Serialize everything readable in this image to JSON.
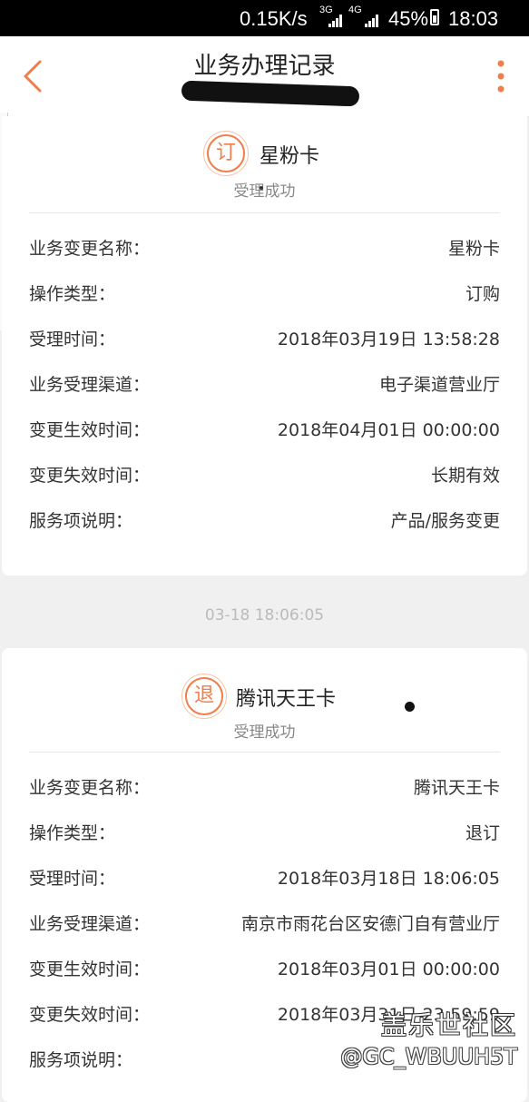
{
  "status_bar": {
    "speed": "0.15K/s",
    "net_a": "3G",
    "net_b": "4G",
    "battery": "45%",
    "time": "18:03"
  },
  "header": {
    "title": "业务办理记录",
    "back_icon": "chevron-left-icon",
    "more_icon": "more-vertical-icon",
    "accent": "#ef7e4a"
  },
  "labels": {
    "name": "业务变更名称：",
    "op_type": "操作类型：",
    "accept_time": "受理时间：",
    "channel": "业务受理渠道：",
    "effective": "变更生效时间：",
    "expire": "变更失效时间：",
    "desc": "服务项说明："
  },
  "records": [
    {
      "badge": "订",
      "name": "星粉卡",
      "status": "受理成功",
      "values": {
        "name": "星粉卡",
        "op_type": "订购",
        "accept_time": "2018年03月19日 13:58:28",
        "channel": "电子渠道营业厅",
        "effective": "2018年04月01日 00:00:00",
        "expire": "长期有效",
        "desc": "产品/服务变更"
      }
    },
    {
      "timestamp": "03-18 18:06:05",
      "badge": "退",
      "name": "腾讯天王卡",
      "status": "受理成功",
      "values": {
        "name": "腾讯天王卡",
        "op_type": "退订",
        "accept_time": "2018年03月18日 18:06:05",
        "channel": "南京市雨花台区安德门自有营业厅",
        "effective": "2018年03月01日 00:00:00",
        "expire": "2018年03月31日 23:59:59"
      }
    }
  ],
  "watermark": {
    "cn": "盖乐世社区",
    "en": "@GC_WBUUH5T"
  }
}
